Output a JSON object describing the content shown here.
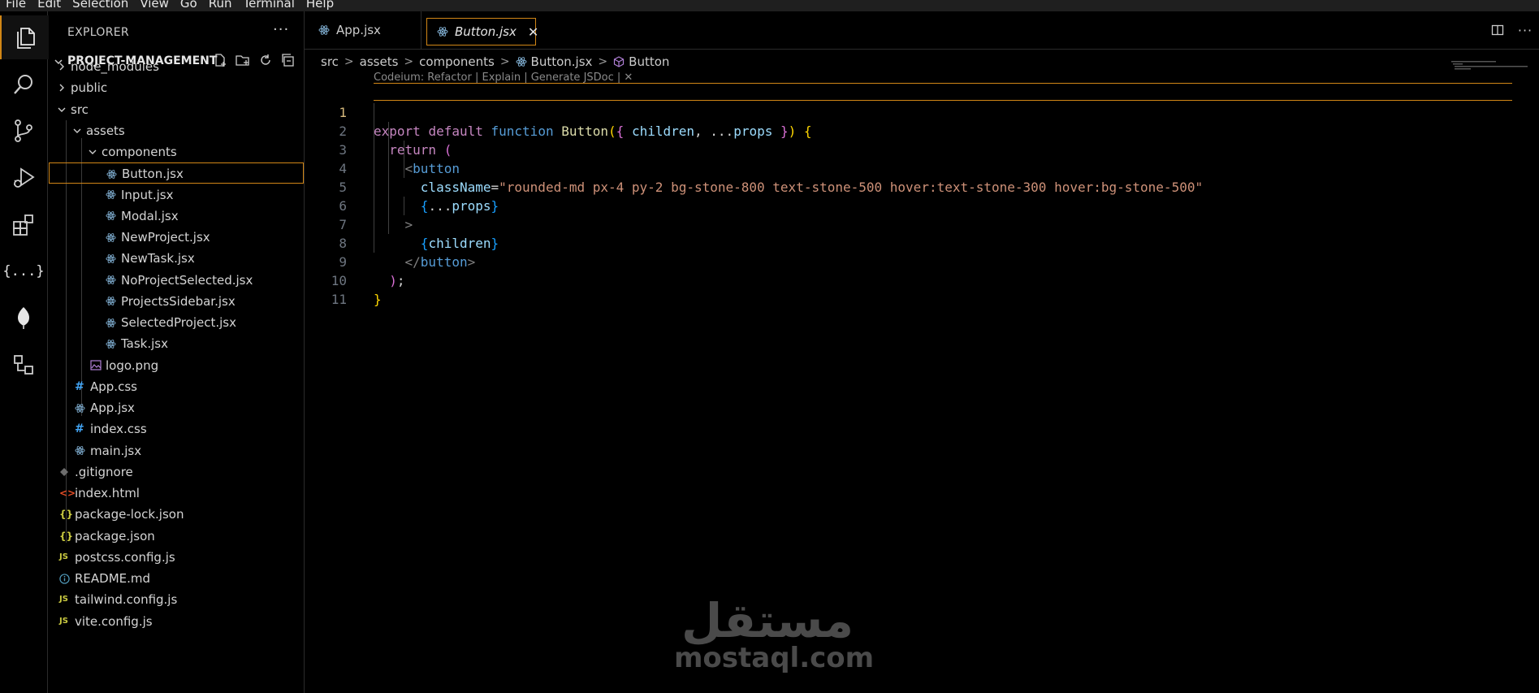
{
  "menubar": [
    "File",
    "Edit",
    "Selection",
    "View",
    "Go",
    "Run",
    "Terminal",
    "Help"
  ],
  "activity_bar": [
    {
      "icon": "files-icon",
      "active": true
    },
    {
      "icon": "search-icon"
    },
    {
      "icon": "source-control-icon"
    },
    {
      "icon": "run-debug-icon"
    },
    {
      "icon": "extensions-icon"
    },
    {
      "icon": "json-braces-icon",
      "text": "{...}"
    },
    {
      "icon": "mongodb-leaf-icon"
    },
    {
      "icon": "remote-explorer-icon"
    }
  ],
  "explorer": {
    "title": "EXPLORER",
    "more": "···",
    "project": "PROJECT-MANAGEMENT",
    "tree": [
      {
        "label": "node_modules",
        "kind": "folder",
        "expanded": false
      },
      {
        "label": "public",
        "kind": "folder",
        "expanded": false
      },
      {
        "label": "src",
        "kind": "folder",
        "expanded": true
      },
      {
        "label": "assets",
        "kind": "folder",
        "expanded": true
      },
      {
        "label": "components",
        "kind": "folder",
        "expanded": true
      },
      {
        "label": "Button.jsx",
        "kind": "react",
        "selected": true
      },
      {
        "label": "Input.jsx",
        "kind": "react"
      },
      {
        "label": "Modal.jsx",
        "kind": "react"
      },
      {
        "label": "NewProject.jsx",
        "kind": "react"
      },
      {
        "label": "NewTask.jsx",
        "kind": "react"
      },
      {
        "label": "NoProjectSelected.jsx",
        "kind": "react"
      },
      {
        "label": "ProjectsSidebar.jsx",
        "kind": "react"
      },
      {
        "label": "SelectedProject.jsx",
        "kind": "react"
      },
      {
        "label": "Task.jsx",
        "kind": "react"
      },
      {
        "label": "logo.png",
        "kind": "image"
      },
      {
        "label": "App.css",
        "kind": "css"
      },
      {
        "label": "App.jsx",
        "kind": "react"
      },
      {
        "label": "index.css",
        "kind": "css"
      },
      {
        "label": "main.jsx",
        "kind": "react"
      },
      {
        "label": ".gitignore",
        "kind": "git"
      },
      {
        "label": "index.html",
        "kind": "html"
      },
      {
        "label": "package-lock.json",
        "kind": "json"
      },
      {
        "label": "package.json",
        "kind": "json"
      },
      {
        "label": "postcss.config.js",
        "kind": "js"
      },
      {
        "label": "README.md",
        "kind": "info"
      },
      {
        "label": "tailwind.config.js",
        "kind": "js"
      },
      {
        "label": "vite.config.js",
        "kind": "js"
      }
    ]
  },
  "tabs": [
    {
      "label": "App.jsx",
      "active": false
    },
    {
      "label": "Button.jsx",
      "active": true,
      "close": "✕"
    }
  ],
  "breadcrumb": [
    "src",
    "assets",
    "components",
    "Button.jsx",
    "Button"
  ],
  "codelens": "Codeium: Refactor | Explain | Generate JSDoc | ✕",
  "code_lines": [
    {
      "n": "1",
      "text": "export default function Button({ children, ...props }) {"
    },
    {
      "n": "2",
      "text": "return ("
    },
    {
      "n": "3",
      "text": "<button"
    },
    {
      "n": "4",
      "text": "className=\"rounded-md px-4 py-2 bg-stone-800 text-stone-500 hover:text-stone-300 hover:bg-stone-500\""
    },
    {
      "n": "5",
      "text": "{...props}"
    },
    {
      "n": "6",
      "text": ">"
    },
    {
      "n": "7",
      "text": "{children}"
    },
    {
      "n": "8",
      "text": "</button>"
    },
    {
      "n": "9",
      "text": ");"
    },
    {
      "n": "10",
      "text": "}"
    },
    {
      "n": "11",
      "text": ""
    }
  ],
  "watermark": {
    "arabic": "مستقل",
    "latin": "mostaql.com"
  },
  "colors": {
    "accent": "#d18616",
    "background": "#000000"
  }
}
